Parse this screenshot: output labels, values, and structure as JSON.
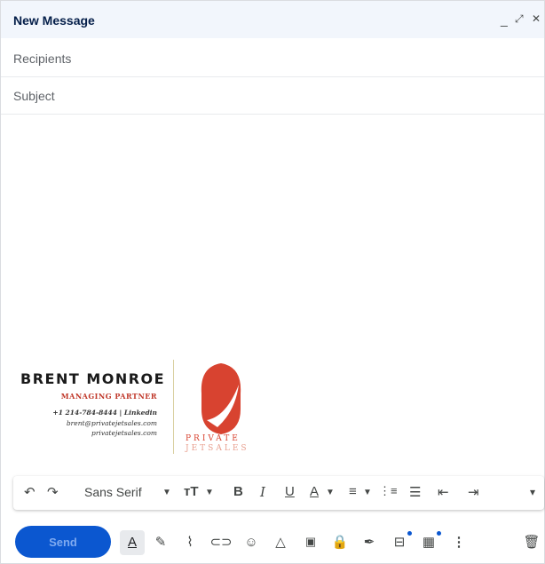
{
  "window": {
    "title": "New Message",
    "controls": {
      "minimize": "_",
      "expand": "⤢",
      "close": "✕"
    }
  },
  "fields": {
    "recipients_placeholder": "Recipients",
    "subject_placeholder": "Subject"
  },
  "signature": {
    "name": "BRENT MONROE",
    "title": "MANAGING PARTNER",
    "phone_line": "+1 214-784-8444 | Linkedin",
    "email": "brent@privatejetsales.com",
    "website": "privatejetsales.com",
    "logo_text_1": "PRIVATE",
    "logo_text_2": "JETSALES"
  },
  "format_toolbar": {
    "font": "Sans Serif",
    "undo": "↶",
    "redo": "↷",
    "size": "тT",
    "bold": "B",
    "italic": "I",
    "underline": "U",
    "text_color": "A",
    "align": "≡",
    "numbered": "⋮≡",
    "bulleted": "☰",
    "indent_less": "⇤",
    "indent_more": "⇥",
    "more": "▾"
  },
  "bottom_toolbar": {
    "send_label": "Send"
  },
  "colors": {
    "accent": "#0b57d0",
    "logo_red": "#d84330"
  }
}
